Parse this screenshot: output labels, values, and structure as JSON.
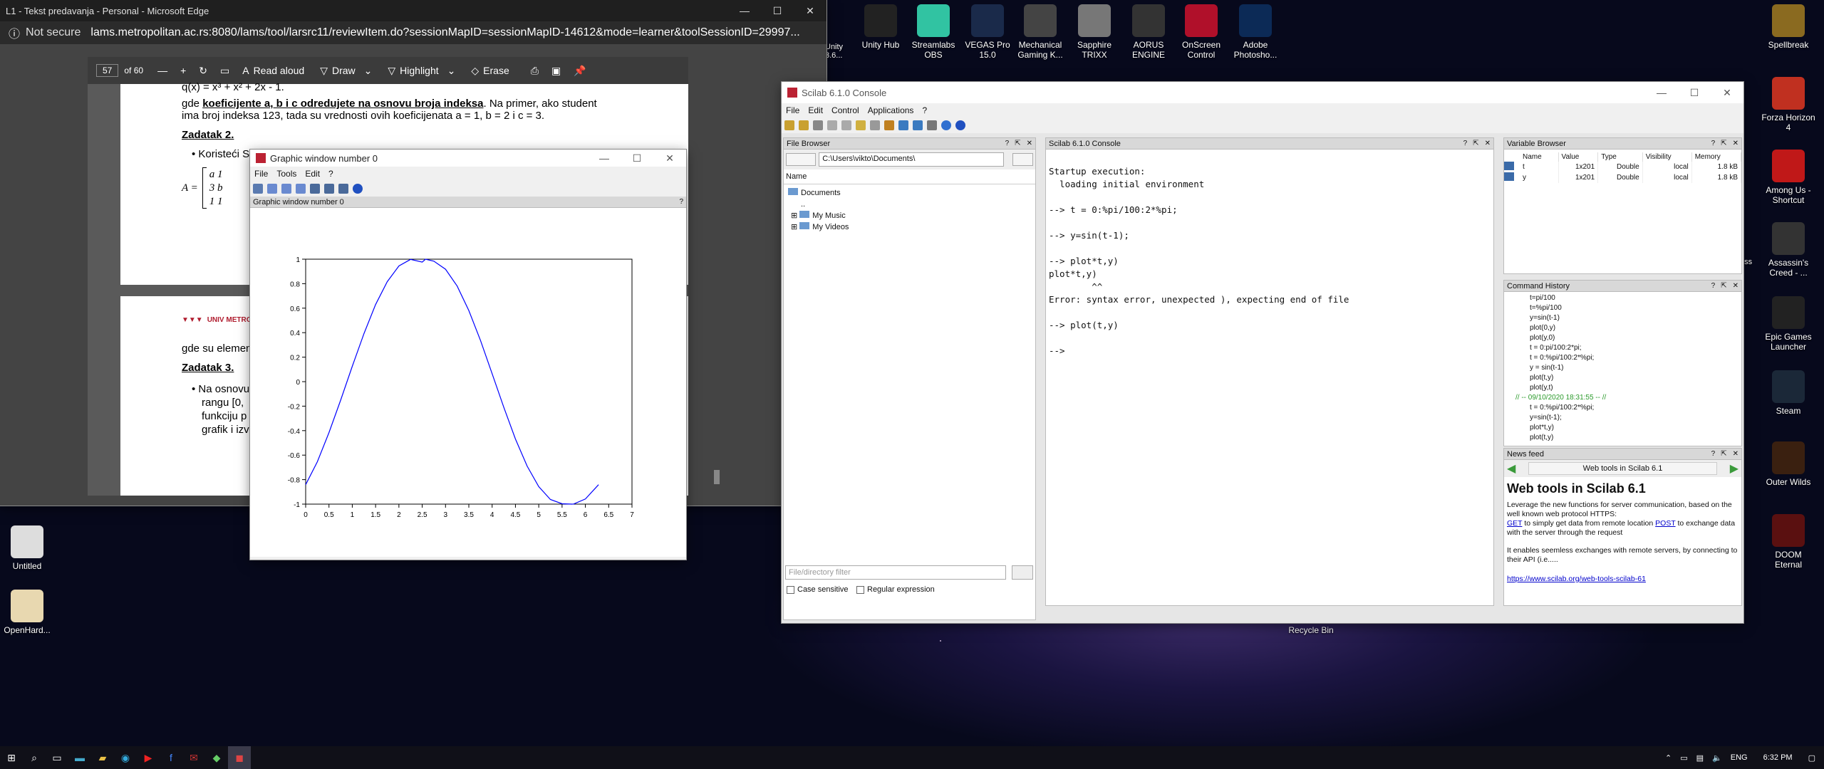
{
  "edge": {
    "title": "L1 - Tekst predavanja - Personal - Microsoft Edge",
    "not_secure": "Not secure",
    "url": "lams.metropolitan.ac.rs:8080/lams/tool/larsrc11/reviewItem.do?sessionMapID=sessionMapID-14612&mode=learner&toolSessionID=29997...",
    "page_num": "57",
    "page_of": "of 60",
    "read_aloud": "Read aloud",
    "draw": "Draw",
    "highlight": "Highlight",
    "erase": "Erase",
    "pdf": {
      "formula_top": "q(x) = x³ + x² + 2x - 1.",
      "para_1a": "gde ",
      "para_1b": "koeficijente a, b i c odredujete na osnovu broja indeksa",
      "para_1c": ". Na primer, ako student",
      "para_2": "ima broj indeksa 123, tada su vrednosti ovih koeficijenata a = 1, b = 2 i c = 3.",
      "zadatak2": "Zadatak 2.",
      "bullet1": "Koristeći S",
      "matrix_A": "A =",
      "m_row1": "a  1",
      "m_row2": "3  b",
      "m_row3": "1  1",
      "logo_text": "UNIV METRO",
      "gde_su": "gde su elemen",
      "zadatak3": "Zadatak 3.",
      "b2_l1": "Na osnovu",
      "b2_l2": "rangu [0,",
      "b2_l3": "funkciju p",
      "b2_l4": "grafik i izv"
    }
  },
  "graphic": {
    "title": "Graphic window number 0",
    "menus": [
      "File",
      "Tools",
      "Edit",
      "?"
    ],
    "header": "Graphic window number 0",
    "help": "?"
  },
  "chart_data": {
    "type": "line",
    "title": "",
    "xlabel": "",
    "ylabel": "",
    "xlim": [
      0,
      7
    ],
    "ylim": [
      -1,
      1
    ],
    "x_ticks": [
      "0",
      "0.5",
      "1",
      "1.5",
      "2",
      "2.5",
      "3",
      "3.5",
      "4",
      "4.5",
      "5",
      "5.5",
      "6",
      "6.5",
      "7"
    ],
    "y_ticks": [
      "1",
      "0.8",
      "0.6",
      "0.4",
      "0.2",
      "0",
      "-0.2",
      "-0.4",
      "-0.6",
      "-0.8",
      "-1"
    ],
    "series": [
      {
        "color": "#0000ff",
        "x": [
          0,
          0.25,
          0.5,
          0.75,
          1,
          1.25,
          1.5,
          1.75,
          2,
          2.25,
          2.5,
          2.571,
          2.75,
          3,
          3.25,
          3.5,
          3.75,
          4,
          4.25,
          4.5,
          4.75,
          5,
          5.25,
          5.5,
          5.713,
          5.75,
          6,
          6.283
        ],
        "y": [
          -0.841,
          -0.654,
          -0.416,
          -0.151,
          0.125,
          0.392,
          0.629,
          0.816,
          0.945,
          0.998,
          0.976,
          1.0,
          0.984,
          0.918,
          0.781,
          0.581,
          0.336,
          0.065,
          -0.21,
          -0.468,
          -0.689,
          -0.857,
          -0.962,
          -0.997,
          -1.0,
          -0.999,
          -0.958,
          -0.841
        ]
      }
    ]
  },
  "scilab": {
    "title": "Scilab 6.1.0 Console",
    "menus": [
      "File",
      "Edit",
      "Control",
      "Applications",
      "?"
    ],
    "file_browser": {
      "title": "File Browser",
      "path": "C:\\Users\\vikto\\Documents\\",
      "col_name": "Name",
      "root": "Documents",
      "items": [
        "..",
        "My Music",
        "My Videos"
      ],
      "filter_placeholder": "File/directory filter",
      "case_sensitive": "Case sensitive",
      "regex": "Regular expression"
    },
    "console": {
      "title": "Scilab 6.1.0 Console",
      "lines": [
        "",
        "Startup execution:",
        "  loading initial environment",
        "",
        "--> t = 0:%pi/100:2*%pi;",
        "",
        "--> y=sin(t-1);",
        "",
        "--> plot*t,y)",
        "plot*t,y)",
        "        ^^",
        "Error: syntax error, unexpected ), expecting end of file",
        "",
        "--> plot(t,y)",
        "",
        "-->"
      ]
    },
    "variable_browser": {
      "title": "Variable Browser",
      "columns": [
        "Name",
        "Value",
        "Type",
        "Visibility",
        "Memory"
      ],
      "rows": [
        {
          "name": "t",
          "value": "1x201",
          "type": "Double",
          "visibility": "local",
          "memory": "1.8 kB"
        },
        {
          "name": "y",
          "value": "1x201",
          "type": "Double",
          "visibility": "local",
          "memory": "1.8 kB"
        }
      ]
    },
    "history": {
      "title": "Command History",
      "items": [
        "t=pi/100",
        "t=%pi/100",
        "y=sin(t-1)",
        "plot(0,y)",
        "plot(y,0)",
        "t = 0:pi/100:2*pi;",
        "t = 0:%pi/100:2*%pi;",
        "y = sin(t-1)",
        "plot(t,y)",
        "plot(y,t)"
      ],
      "session": "// -- 09/10/2020 18:31:55 -- //",
      "session_items": [
        "t = 0:%pi/100:2*%pi;",
        "y=sin(t-1);",
        "plot*t,y)",
        "plot(t,y)"
      ]
    },
    "news": {
      "title": "News feed",
      "nav_title": "Web tools in Scilab 6.1",
      "heading": "Web tools in Scilab 6.1",
      "p1": "Leverage the new functions for server communication, based on the well known web protocol HTTPS:",
      "get": "GET",
      "p2a": " to simply get data from remote location ",
      "post": "POST",
      "p2b": " to exchange data with the server through the request",
      "p3": "It enables seemless exchanges with remote servers, by connecting to their API (i.e.....",
      "link": "https://www.scilab.org/web-tools-scilab-61"
    }
  },
  "desktop": {
    "top_icons": [
      {
        "label": "Unity Hub",
        "color": "#222"
      },
      {
        "label": "Streamlabs OBS",
        "color": "#31c3a2"
      },
      {
        "label": "VEGAS Pro 15.0",
        "color": "#1a2a4a"
      },
      {
        "label": "Mechanical Gaming K...",
        "color": "#444"
      },
      {
        "label": "Sapphire TRIXX",
        "color": "#777"
      },
      {
        "label": "AORUS ENGINE",
        "color": "#333"
      },
      {
        "label": "OnScreen Control",
        "color": "#b0102a"
      },
      {
        "label": "Adobe Photosho...",
        "color": "#0c2a56"
      }
    ],
    "right_icons": [
      {
        "label": "Spellbreak",
        "color": "#8a6a20"
      },
      {
        "label": "Forza Horizon 4",
        "color": "#c03020"
      },
      {
        "label": "Among Us - Shortcut",
        "color": "#c01818"
      },
      {
        "label": "Assassin's Creed - ...",
        "color": "#333"
      },
      {
        "label": "Epic Games Launcher",
        "color": "#222"
      },
      {
        "label": "Steam",
        "color": "#1b2838"
      },
      {
        "label": "Outer Wilds",
        "color": "#3a2010"
      },
      {
        "label": "DOOM Eternal",
        "color": "#5a1010"
      }
    ],
    "left_icons": [
      {
        "label": "Untitled",
        "color": "#ddd"
      },
      {
        "label": "OpenHard...",
        "color": "#e8d8b0"
      }
    ],
    "unity_partial": "Unity\n3.6...",
    "recycle": "Recycle Bin",
    "partial_right": "ess"
  },
  "taskbar": {
    "lang": "ENG",
    "time": "6:32 PM"
  }
}
